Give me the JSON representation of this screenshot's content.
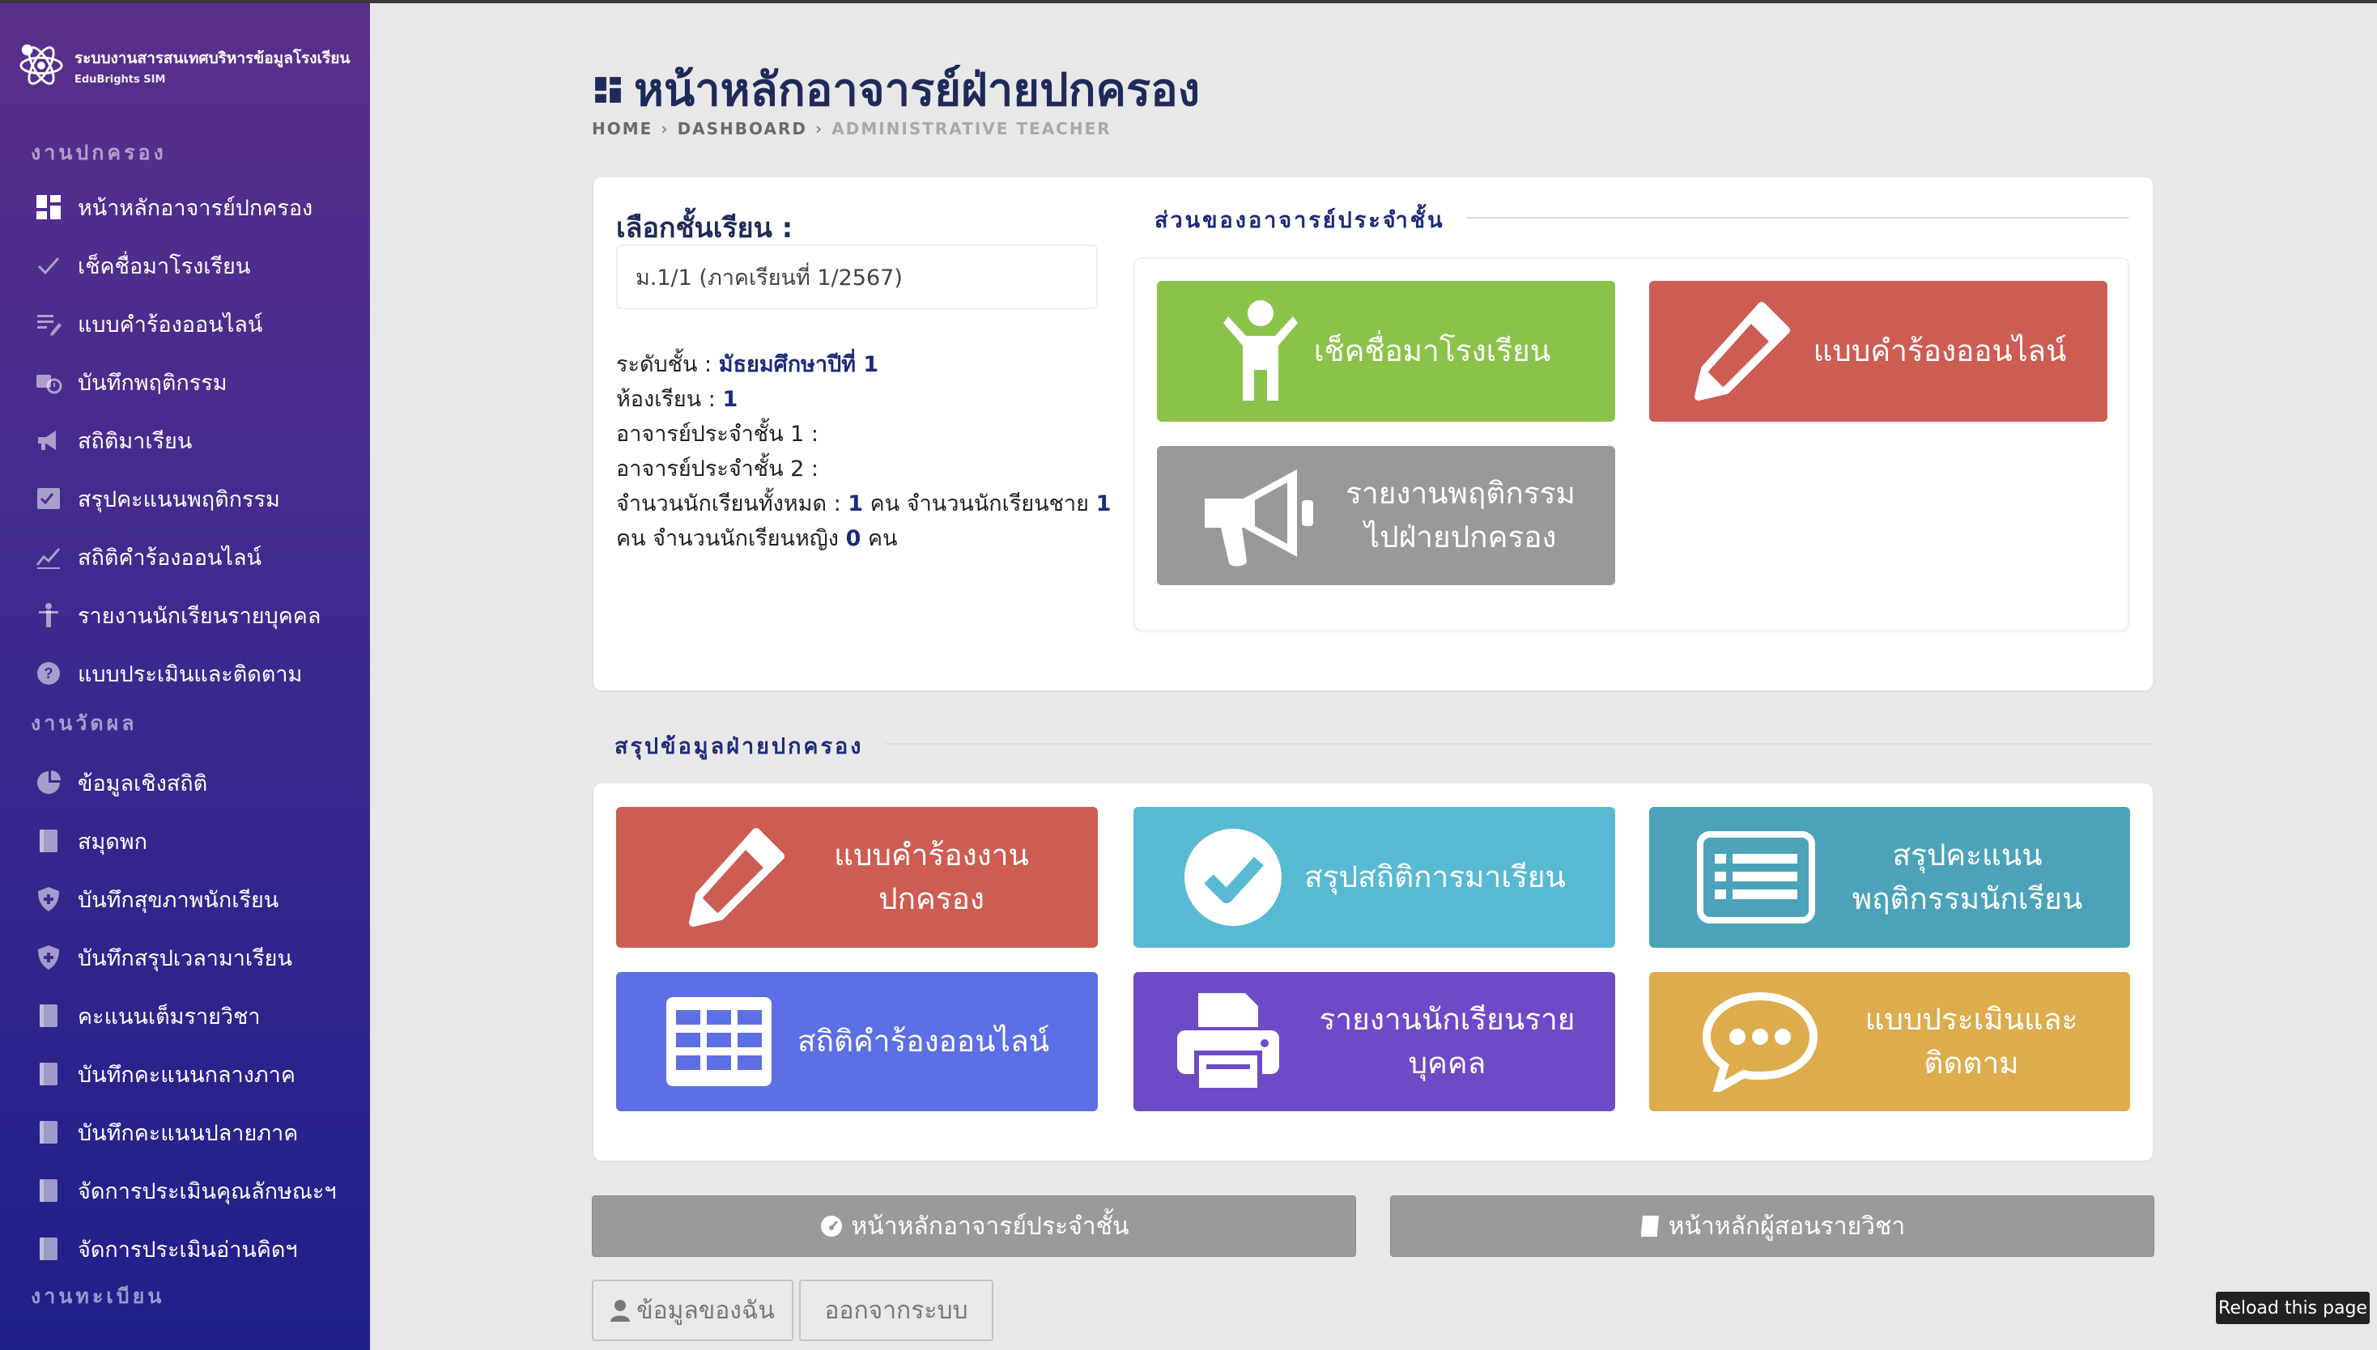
{
  "brand": {
    "title": "ระบบงานสารสนเทศบริหารข้อมูลโรงเรียน",
    "subtitle": "EduBrights SIM"
  },
  "sidebar": {
    "sections": [
      {
        "title": "งานปกครอง",
        "items": [
          {
            "label": "หน้าหลักอาจารย์ปกครอง",
            "icon": "dashboard-icon"
          },
          {
            "label": "เช็คชื่อมาโรงเรียน",
            "icon": "check-icon"
          },
          {
            "label": "แบบคำร้องออนไลน์",
            "icon": "form-list-icon"
          },
          {
            "label": "บันทึกพฤติกรรม",
            "icon": "behavior-icon"
          },
          {
            "label": "สถิติมาเรียน",
            "icon": "megaphone-icon"
          },
          {
            "label": "สรุปคะแนนพฤติกรรม",
            "icon": "checklist-icon"
          },
          {
            "label": "สถิติคำร้องออนไลน์",
            "icon": "trend-icon"
          },
          {
            "label": "รายงานนักเรียนรายบุคคล",
            "icon": "person-icon"
          },
          {
            "label": "แบบประเมินและติดตาม",
            "icon": "question-icon"
          }
        ]
      },
      {
        "title": "งานวัดผล",
        "items": [
          {
            "label": "ข้อมูลเชิงสถิติ",
            "icon": "pie-chart-icon"
          },
          {
            "label": "สมุดพก",
            "icon": "book-icon"
          },
          {
            "label": "บันทึกสุขภาพนักเรียน",
            "icon": "shield-icon"
          },
          {
            "label": "บันทึกสรุปเวลามาเรียน",
            "icon": "shield-icon"
          },
          {
            "label": "คะแนนเต็มรายวิชา",
            "icon": "book-icon"
          },
          {
            "label": "บันทึกคะแนนกลางภาค",
            "icon": "book-icon"
          },
          {
            "label": "บันทึกคะแนนปลายภาค",
            "icon": "book-icon"
          },
          {
            "label": "จัดการประเมินคุณลักษณะฯ",
            "icon": "book-icon"
          },
          {
            "label": "จัดการประเมินอ่านคิดฯ",
            "icon": "book-icon"
          }
        ]
      },
      {
        "title": "งานทะเบียน",
        "items": []
      }
    ]
  },
  "page": {
    "title": "หน้าหลักอาจารย์ฝ่ายปกครอง",
    "breadcrumb": [
      "HOME",
      "DASHBOARD",
      "ADMINISTRATIVE TEACHER"
    ]
  },
  "class_panel": {
    "select_label": "เลือกชั้นเรียน :",
    "selected_class": "ม.1/1 (ภาคเรียนที่ 1/2567)",
    "level_label": "ระดับชั้น :",
    "level_value": "มัธยมศึกษาปีที่ 1",
    "room_label": "ห้องเรียน :",
    "room_value": "1",
    "teacher1_label": "อาจารย์ประจำชั้น 1 :",
    "teacher2_label": "อาจารย์ประจำชั้น 2 :",
    "total_label": "จำนวนนักเรียนทั้งหมด :",
    "total_value": "1",
    "unit_person": "คน",
    "male_label": "จำนวนนักเรียนชาย",
    "male_value": "1",
    "female_label": "จำนวนนักเรียนหญิง",
    "female_value": "0"
  },
  "homeroom": {
    "title": "ส่วนของอาจารย์ประจำชั้น",
    "tiles": [
      {
        "label": "เช็คชื่อมาโรงเรียน",
        "icon": "child-icon",
        "color": "#8bc34a"
      },
      {
        "label": "แบบคำร้องออนไลน์",
        "icon": "pencil-icon",
        "color": "#cd5c53"
      },
      {
        "label": "รายงานพฤติกรรม\nไปฝ่ายปกครอง",
        "icon": "bullhorn-icon",
        "color": "#999999"
      }
    ]
  },
  "summary": {
    "title": "สรุปข้อมูลฝ่ายปกครอง",
    "tiles": [
      {
        "label": "แบบคำร้องงาน\nปกครอง",
        "icon": "pencil-icon",
        "color": "#cd5c53"
      },
      {
        "label": "สรุปสถิติการมาเรียน",
        "icon": "check-circle-icon",
        "color": "#58bad2"
      },
      {
        "label": "สรุปคะแนน\nพฤติกรรมนักเรียน",
        "icon": "list-alt-icon",
        "color": "#4ca3b9"
      },
      {
        "label": "สถิติคำร้องออนไลน์",
        "icon": "table-icon",
        "color": "#5d6fe4"
      },
      {
        "label": "รายงานนักเรียนราย\nบุคคล",
        "icon": "print-icon",
        "color": "#6f4ac7"
      },
      {
        "label": "แบบประเมินและ\nติดตาม",
        "icon": "comment-icon",
        "color": "#dcac4d"
      }
    ]
  },
  "footer_buttons": {
    "homeroom_home": "หน้าหลักอาจารย์ประจำชั้น",
    "subject_home": "หน้าหลักผู้สอนรายวิชา",
    "my_profile": "ข้อมูลของฉัน",
    "logout": "ออกจากระบบ"
  },
  "reload_label": "Reload this page"
}
